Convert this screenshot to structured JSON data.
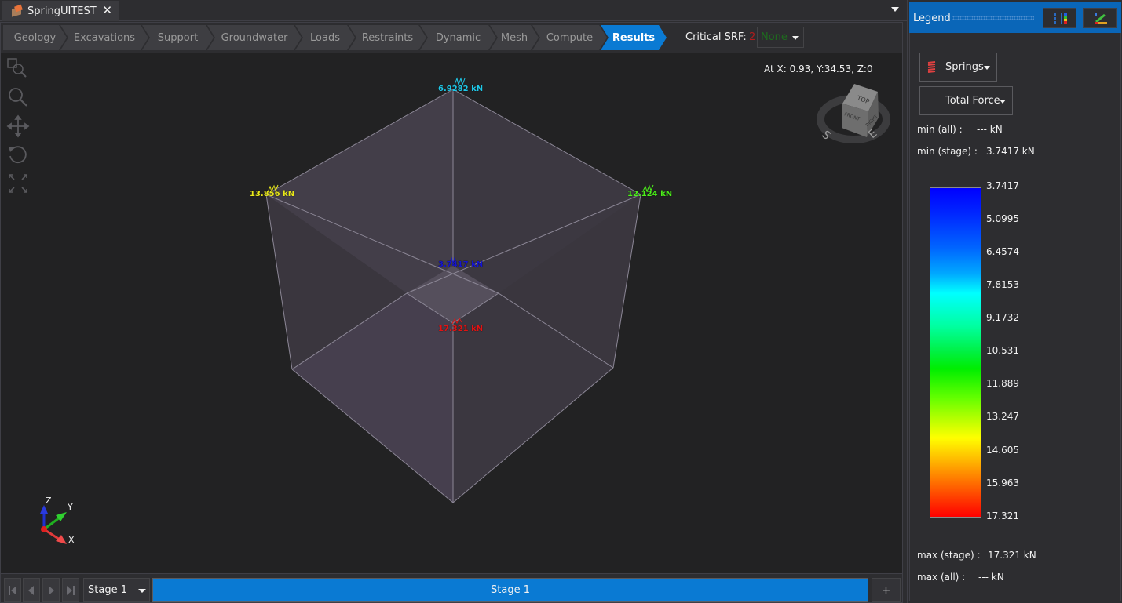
{
  "document_tab": {
    "title": "SpringUITEST",
    "close_glyph": "✕",
    "icon": "app-cube-icon"
  },
  "workflow": {
    "steps": [
      {
        "label": "Geology",
        "active": false
      },
      {
        "label": "Excavations",
        "active": false
      },
      {
        "label": "Support",
        "active": false
      },
      {
        "label": "Groundwater",
        "active": false
      },
      {
        "label": "Loads",
        "active": false
      },
      {
        "label": "Restraints",
        "active": false
      },
      {
        "label": "Dynamic",
        "active": false
      },
      {
        "label": "Mesh",
        "active": false
      },
      {
        "label": "Compute",
        "active": false
      },
      {
        "label": "Results",
        "active": true
      }
    ],
    "critical_srf_label": "Critical SRF:",
    "critical_srf_marker": "2",
    "critical_srf_value": "None"
  },
  "viewport": {
    "coordinate_readout": "At X: 0.93, Y:34.53, Z:0",
    "tools": [
      "zoom-window-icon",
      "zoom-icon",
      "pan-icon",
      "rotate-icon",
      "zoom-extents-icon"
    ],
    "view_cube": {
      "faces": [
        "TOP",
        "FRONT",
        "RIGHT"
      ],
      "compass": [
        "S",
        "E"
      ]
    },
    "axes": {
      "x": "X",
      "y": "Y",
      "z": "Z"
    },
    "spring_labels": [
      {
        "text": "6.9282 kN",
        "color": "#1fc8e8"
      },
      {
        "text": "13.856 kN",
        "color": "#e8e81a"
      },
      {
        "text": "12.124 kN",
        "color": "#4cf01a"
      },
      {
        "text": "3.7417 kN",
        "color": "#1414d2"
      },
      {
        "text": "17.321 kN",
        "color": "#e01414"
      }
    ]
  },
  "stage_bar": {
    "nav": [
      "first-stage-icon",
      "previous-stage-icon",
      "next-stage-icon",
      "last-stage-icon"
    ],
    "selected_stage": "Stage 1",
    "stage_tab": "Stage 1",
    "add_label": "+"
  },
  "legend": {
    "title": "Legend",
    "entity": "Springs",
    "quantity": "Total Force",
    "min_all_label": "min (all) :",
    "min_all_value": "--- kN",
    "min_stage_label": "min (stage) :",
    "min_stage_value": "3.7417 kN",
    "max_stage_label": "max (stage) :",
    "max_stage_value": "17.321 kN",
    "max_all_label": "max (all) :",
    "max_all_value": "--- kN",
    "ticks": [
      "3.7417",
      "5.0995",
      "6.4574",
      "7.8153",
      "9.1732",
      "10.531",
      "11.889",
      "13.247",
      "14.605",
      "15.963",
      "17.321"
    ],
    "colors": {
      "header": "#0a66b8",
      "accent": "#0a7ad3"
    }
  }
}
